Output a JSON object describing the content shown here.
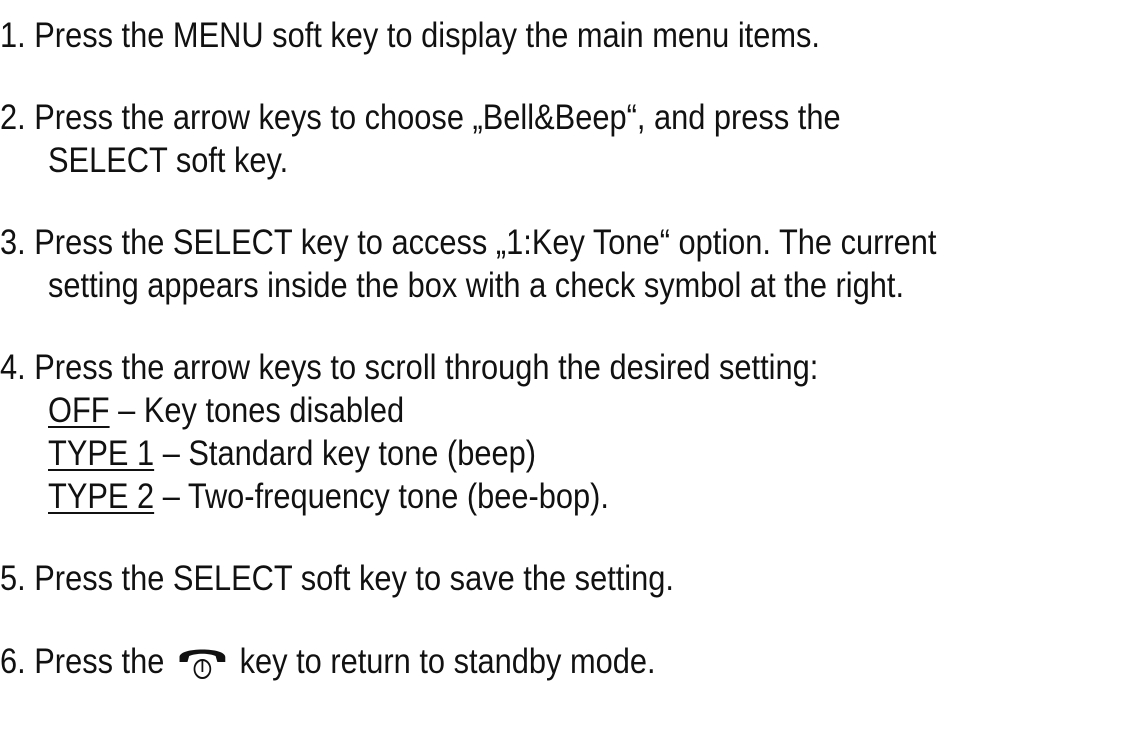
{
  "steps": [
    {
      "num": "1.",
      "lines": [
        "Press the MENU soft key to display the main menu items."
      ]
    },
    {
      "num": "2.",
      "lines": [
        "Press the arrow keys to choose „Bell&Beep“, and press the",
        "SELECT soft key."
      ]
    },
    {
      "num": "3.",
      "lines": [
        "Press the SELECT key to access „1:Key Tone“ option. The current",
        "setting appears inside the box with a check symbol at the right."
      ]
    },
    {
      "num": "4.",
      "lines": [
        "Press the arrow keys to scroll through the desired setting:"
      ],
      "options": [
        {
          "term": "OFF",
          "desc": " – Key tones disabled"
        },
        {
          "term": "TYPE 1",
          "desc": " – Standard key tone (beep)"
        },
        {
          "term": "TYPE 2",
          "desc": " – Two-frequency tone (bee-bop)."
        }
      ]
    },
    {
      "num": "5.",
      "lines": [
        "Press the SELECT soft key to save the setting."
      ]
    },
    {
      "num": "6.",
      "before_icon": "Press the",
      "icon": "end-call-key-icon",
      "after_icon": "key to return to standby mode."
    }
  ]
}
